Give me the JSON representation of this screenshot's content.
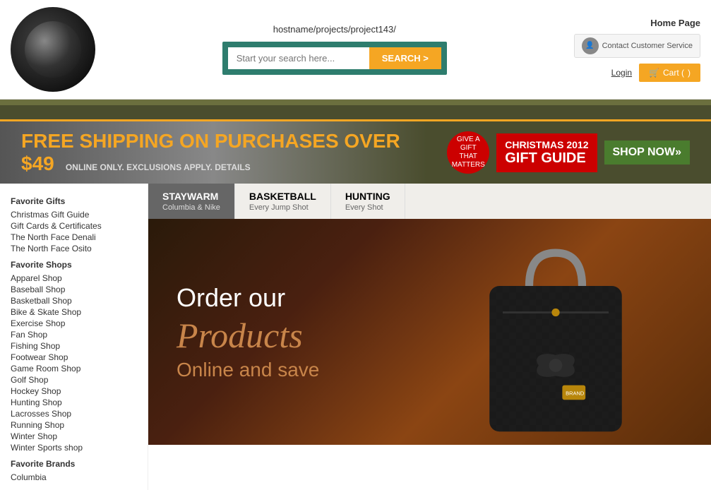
{
  "header": {
    "url": "hostname/projects/project143/",
    "search_placeholder": "Start your search here...",
    "search_button": "SEARCH >",
    "home_page": "Home Page",
    "contact_label": "Contact Customer Service",
    "login": "Login",
    "cart": "Cart ("
  },
  "banner": {
    "text1": "FREE SHIPPING ON PURCHASES OVER $",
    "amount": "49",
    "text2": "ONLINE ONLY.",
    "text3": "EXCLUSIONS APPLY. DETAILS",
    "gift_line1": "GIVE A",
    "gift_line2": "GIFT THAT",
    "gift_line3": "MATTERS",
    "christmas": "CHRISTMAS 2012",
    "gift_guide": "GIFT GUIDE",
    "shop_now": "SHOP NOW»"
  },
  "tabs": [
    {
      "id": "staywarm",
      "title": "STAYWARM",
      "sub": "Columbia & Nike",
      "active": true
    },
    {
      "id": "basketball",
      "title": "BASKETBALL",
      "sub": "Every Jump Shot",
      "active": false
    },
    {
      "id": "hunting",
      "title": "HUNTING",
      "sub": "Every Shot",
      "active": false
    }
  ],
  "hero": {
    "line1": "Order our",
    "line2": "Products",
    "line3": "Online and save"
  },
  "sidebar": {
    "section1_title": "Favorite Gifts",
    "section1_items": [
      "Christmas Gift Guide",
      "Gift Cards & Certificates",
      "The North Face Denali",
      "The North Face Osito"
    ],
    "section2_title": "Favorite Shops",
    "section2_items": [
      "Apparel Shop",
      "Baseball Shop",
      "Basketball Shop",
      "Bike & Skate Shop",
      "Exercise Shop",
      "Fan Shop",
      "Fishing Shop",
      "Footwear Shop",
      "Game Room Shop",
      "Golf Shop",
      "Hockey Shop",
      "Hunting Shop",
      "Lacrosses Shop",
      "Running Shop",
      "Winter Shop",
      "Winter Sports shop"
    ],
    "section3_title": "Favorite Brands",
    "section3_items": [
      "Columbia"
    ]
  }
}
